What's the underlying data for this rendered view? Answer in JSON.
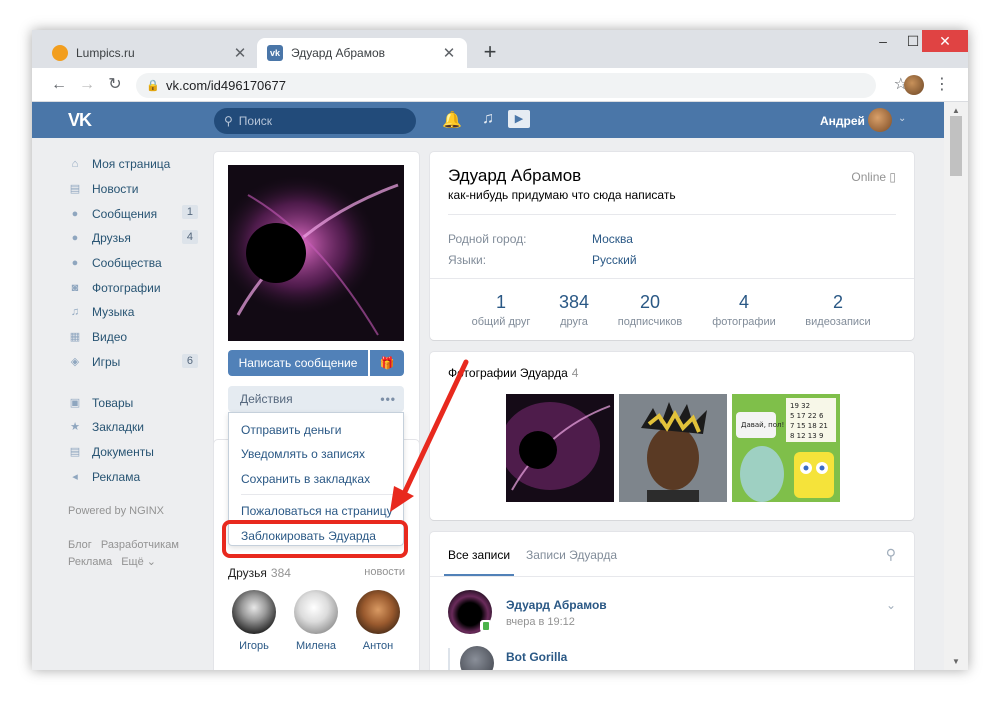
{
  "browser": {
    "tabs": [
      {
        "title": "Lumpics.ru",
        "active": false,
        "favicon": "orange-circle-icon"
      },
      {
        "title": "Эдуард Абрамов",
        "active": true,
        "favicon": "vk-icon"
      }
    ],
    "new_tab_symbol": "+",
    "url": "vk.com/id496170677",
    "window_controls": {
      "minimize": "–",
      "maximize": "☐",
      "close": "✕"
    }
  },
  "vk": {
    "logo": "VK",
    "search_placeholder": "Поиск",
    "user_name": "Андрей",
    "menu": [
      {
        "label": "Моя страница",
        "icon": "home-icon",
        "glyph": "⌂",
        "count": ""
      },
      {
        "label": "Новости",
        "icon": "news-icon",
        "glyph": "▤",
        "count": ""
      },
      {
        "label": "Сообщения",
        "icon": "messages-icon",
        "glyph": "●",
        "count": "1"
      },
      {
        "label": "Друзья",
        "icon": "friends-icon",
        "glyph": "●",
        "count": "4"
      },
      {
        "label": "Сообщества",
        "icon": "communities-icon",
        "glyph": "●",
        "count": ""
      },
      {
        "label": "Фотографии",
        "icon": "photos-icon",
        "glyph": "◙",
        "count": ""
      },
      {
        "label": "Музыка",
        "icon": "music-icon",
        "glyph": "♫",
        "count": ""
      },
      {
        "label": "Видео",
        "icon": "video-icon",
        "glyph": "▦",
        "count": ""
      },
      {
        "label": "Игры",
        "icon": "games-icon",
        "glyph": "◈",
        "count": "6"
      }
    ],
    "menu2": [
      {
        "label": "Товары",
        "icon": "goods-icon",
        "glyph": "▣"
      },
      {
        "label": "Закладки",
        "icon": "bookmarks-icon",
        "glyph": "★"
      },
      {
        "label": "Документы",
        "icon": "documents-icon",
        "glyph": "▤"
      },
      {
        "label": "Реклама",
        "icon": "ads-icon",
        "glyph": "◂"
      }
    ],
    "powered_by": "Powered by NGINX",
    "footer_links": [
      "Блог",
      "Разработчикам",
      "Реклама",
      "Ещё ⌄"
    ]
  },
  "profile": {
    "name": "Эдуард Абрамов",
    "status": "как-нибудь придумаю что сюда написать",
    "online": "Online ▯",
    "fields": [
      {
        "label": "Родной город:",
        "value": "Москва"
      },
      {
        "label": "Языки:",
        "value": "Русский"
      }
    ],
    "stats": [
      {
        "value": "1",
        "label": "общий друг"
      },
      {
        "value": "384",
        "label": "друга"
      },
      {
        "value": "20",
        "label": "подписчиков"
      },
      {
        "value": "4",
        "label": "фотографии"
      },
      {
        "value": "2",
        "label": "видеозаписи"
      }
    ],
    "send_message": "Написать сообщение",
    "gift_icon": "🎁",
    "actions_label": "Действия",
    "actions_dots": "•••",
    "actions_menu": [
      "Отправить деньги",
      "Уведомлять о записях",
      "Сохранить в закладках",
      "Пожаловаться на страницу",
      "Заблокировать Эдуарда"
    ],
    "friends_title": "Друзья",
    "friends_count": "384",
    "friends_news": "новости",
    "friends": [
      "Игорь",
      "Милена",
      "Антон"
    ],
    "photos_title": "Фотографии Эдуарда",
    "photos_count": "4",
    "wall_tabs": [
      "Все записи",
      "Записи Эдуарда"
    ],
    "post": {
      "author": "Эдуард Абрамов",
      "time": "вчера в 19:12",
      "sub_author": "Bot Gorilla"
    }
  },
  "colors": {
    "vk_blue": "#4a76a8",
    "button_blue": "#5181b8",
    "link": "#2a5885",
    "highlight_red": "#e8291e"
  }
}
